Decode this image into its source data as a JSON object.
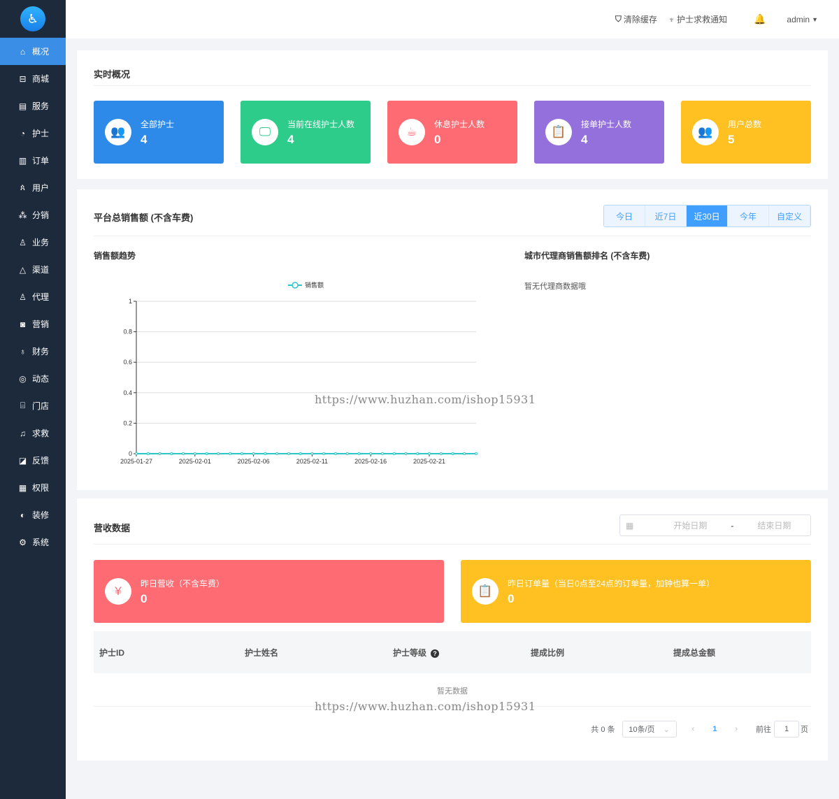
{
  "sidebar": {
    "items": [
      {
        "label": "概况",
        "icon": "home-icon",
        "g": "⌂"
      },
      {
        "label": "商城",
        "icon": "bag-icon",
        "g": "⊟"
      },
      {
        "label": "服务",
        "icon": "calendar-icon",
        "g": "▤"
      },
      {
        "label": "护士",
        "icon": "dashboard-icon",
        "g": "◔"
      },
      {
        "label": "订单",
        "icon": "document-icon",
        "g": "▥"
      },
      {
        "label": "用户",
        "icon": "users-icon",
        "g": "ጰ"
      },
      {
        "label": "分销",
        "icon": "share-icon",
        "g": "⁂"
      },
      {
        "label": "业务",
        "icon": "user-icon",
        "g": "♙"
      },
      {
        "label": "渠道",
        "icon": "recycle-icon",
        "g": "△"
      },
      {
        "label": "代理",
        "icon": "agent-icon",
        "g": "♙"
      },
      {
        "label": "营销",
        "icon": "camera-icon",
        "g": "◙"
      },
      {
        "label": "财务",
        "icon": "money-bag-icon",
        "g": "♁"
      },
      {
        "label": "动态",
        "icon": "compass-icon",
        "g": "◎"
      },
      {
        "label": "门店",
        "icon": "store-icon",
        "g": "⌸"
      },
      {
        "label": "求救",
        "icon": "bell-icon",
        "g": "♫"
      },
      {
        "label": "反馈",
        "icon": "edit-icon",
        "g": "◪"
      },
      {
        "label": "权限",
        "icon": "lock-icon",
        "g": "▦"
      },
      {
        "label": "装修",
        "icon": "brush-icon",
        "g": "◐"
      },
      {
        "label": "系统",
        "icon": "gear-icon",
        "g": "⚙"
      }
    ]
  },
  "header": {
    "clear_cache": "清除缓存",
    "rescue_notice": "护士求救通知",
    "user": "admin"
  },
  "overview": {
    "title": "实时概况",
    "cards": [
      {
        "label": "全部护士",
        "value": "4",
        "color": "#2e8ae8",
        "g": "👥"
      },
      {
        "label": "当前在线护士人数",
        "value": "4",
        "color": "#2dcc8b",
        "g": "🖵"
      },
      {
        "label": "休息护士人数",
        "value": "0",
        "color": "#fe6b72",
        "g": "☕"
      },
      {
        "label": "接单护士人数",
        "value": "4",
        "color": "#9370db",
        "g": "📋"
      },
      {
        "label": "用户总数",
        "value": "5",
        "color": "#ffc022",
        "g": "👥"
      }
    ]
  },
  "sales": {
    "title": "平台总销售额 (不含车费)",
    "tabs": [
      "今日",
      "近7日",
      "近30日",
      "今年",
      "自定义"
    ],
    "active_tab": 2,
    "trend_title": "销售额趋势",
    "ranking_title": "城市代理商销售额排名 (不含车费)",
    "ranking_empty": "暂无代理商数据哦"
  },
  "chart_data": {
    "type": "line",
    "legend": [
      "销售额"
    ],
    "legend_position": "top-center",
    "x": [
      "2025-01-27",
      "2025-01-28",
      "2025-01-29",
      "2025-01-30",
      "2025-01-31",
      "2025-02-01",
      "2025-02-02",
      "2025-02-03",
      "2025-02-04",
      "2025-02-05",
      "2025-02-06",
      "2025-02-07",
      "2025-02-08",
      "2025-02-09",
      "2025-02-10",
      "2025-02-11",
      "2025-02-12",
      "2025-02-13",
      "2025-02-14",
      "2025-02-15",
      "2025-02-16",
      "2025-02-17",
      "2025-02-18",
      "2025-02-19",
      "2025-02-20",
      "2025-02-21",
      "2025-02-22",
      "2025-02-23",
      "2025-02-24",
      "2025-02-25"
    ],
    "series": [
      {
        "name": "销售额",
        "values": [
          0,
          0,
          0,
          0,
          0,
          0,
          0,
          0,
          0,
          0,
          0,
          0,
          0,
          0,
          0,
          0,
          0,
          0,
          0,
          0,
          0,
          0,
          0,
          0,
          0,
          0,
          0,
          0,
          0,
          0
        ],
        "color": "#2ec7c9"
      }
    ],
    "xticks": [
      "2025-01-27",
      "2025-02-01",
      "2025-02-06",
      "2025-02-11",
      "2025-02-16",
      "2025-02-21"
    ],
    "yticks": [
      "0",
      "0.2",
      "0.4",
      "0.6",
      "0.8",
      "1"
    ],
    "ylim": [
      0,
      1
    ],
    "grid": true
  },
  "revenue": {
    "title": "营收数据",
    "start_placeholder": "开始日期",
    "sep": "-",
    "end_placeholder": "结束日期",
    "cards": [
      {
        "label": "昨日营收（不含车费）",
        "value": "0",
        "color": "#fe6b72",
        "g": "¥"
      },
      {
        "label": "昨日订单量（当日0点至24点的订单量，加钟也算一单）",
        "value": "0",
        "color": "#ffc022",
        "g": "📋"
      }
    ],
    "columns": [
      "护士ID",
      "护士姓名",
      "护士等级",
      "提成比例",
      "提成总金额"
    ],
    "empty": "暂无数据",
    "pagination": {
      "total": "共 0 条",
      "page_size": "10条/页",
      "current": "1",
      "goto": "前往",
      "goto_value": "1",
      "page_unit": "页"
    }
  },
  "watermark": "https://www.huzhan.com/ishop15931"
}
